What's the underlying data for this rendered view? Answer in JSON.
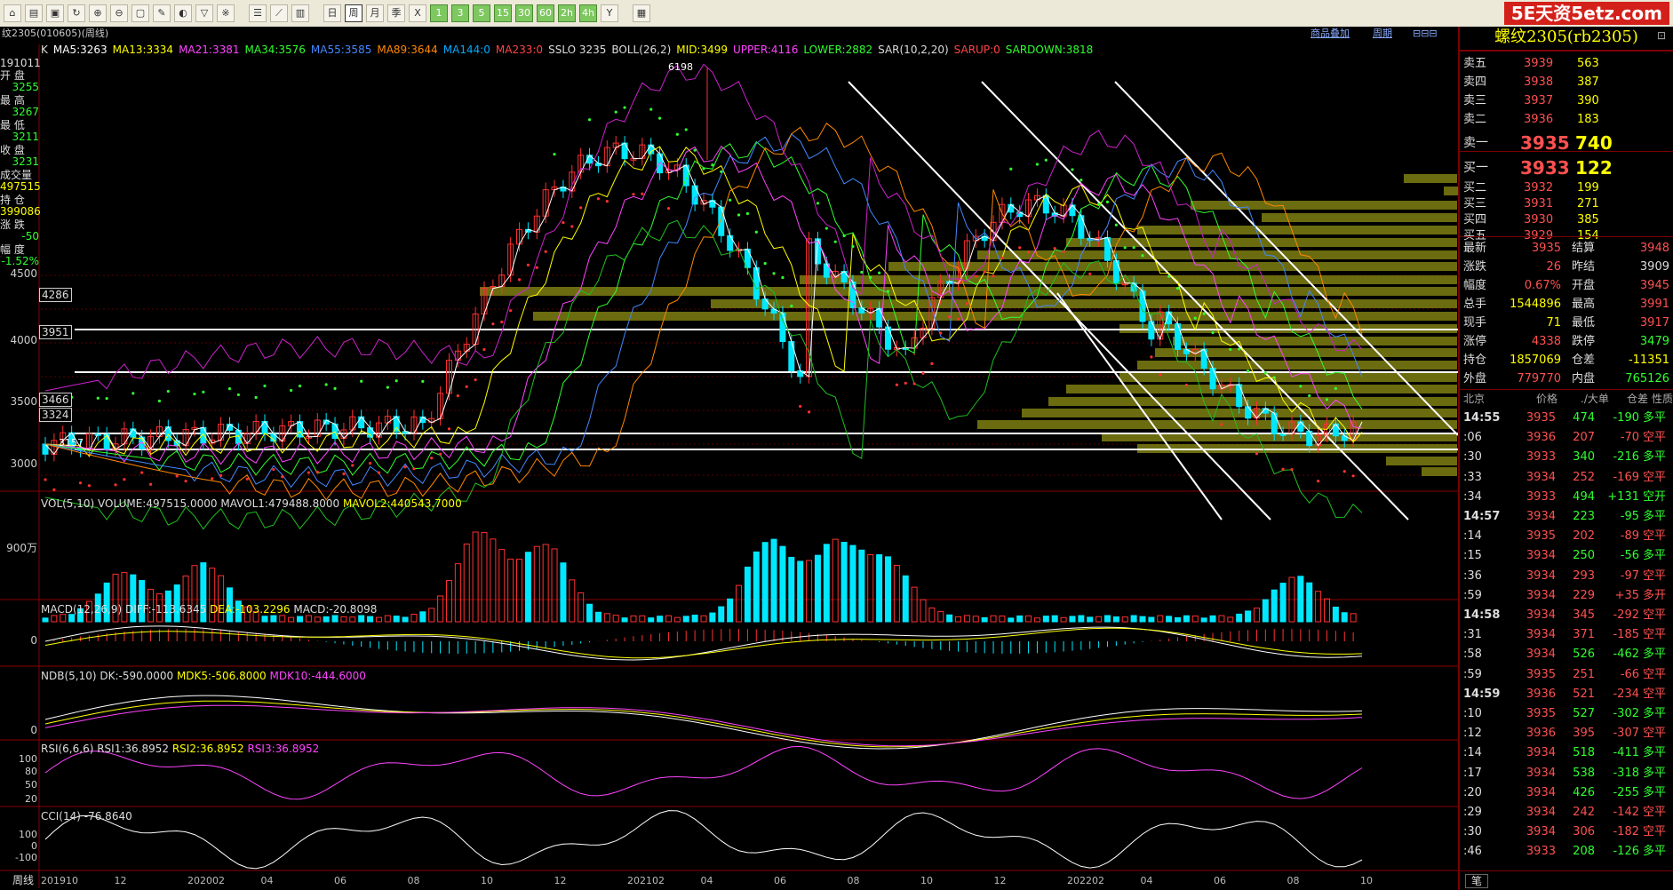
{
  "toolbar": {
    "icons": [
      "home-icon",
      "folder-icon",
      "open-icon",
      "refresh-icon",
      "zoom-in-icon",
      "zoom-out-icon",
      "window-icon",
      "pencil-icon",
      "color-icon",
      "filter-icon",
      "new-icon",
      "list-icon",
      "chart-icon",
      "tick-icon",
      "daily-icon",
      "weekly-icon",
      "monthly-icon",
      "quarter-icon",
      "x-icon",
      "1min-icon",
      "3min-icon",
      "5min-icon",
      "15min-icon",
      "30min-icon",
      "60min-icon",
      "2h-icon",
      "4h-icon",
      "year-icon",
      "calc-icon"
    ],
    "period_buttons": [
      "日",
      "周",
      "月",
      "季",
      "X",
      "1",
      "3",
      "5",
      "15",
      "30",
      "60",
      "2h",
      "4h",
      "Y"
    ],
    "brand": "5E天资5etz.com"
  },
  "chart_header": {
    "title": "纹2305(010605)(周线)",
    "links": [
      "商品叠加",
      "周期"
    ],
    "indicators": [
      {
        "text": "K",
        "color": "#dddddd"
      },
      {
        "text": "MA5:3263",
        "color": "#ffffff"
      },
      {
        "text": "MA13:3334",
        "color": "#ffff00"
      },
      {
        "text": "MA21:3381",
        "color": "#ff44ff"
      },
      {
        "text": "MA34:3576",
        "color": "#30ff30"
      },
      {
        "text": "MA55:3585",
        "color": "#4488ff"
      },
      {
        "text": "MA89:3644",
        "color": "#ff8800"
      },
      {
        "text": "MA144:0",
        "color": "#00aaff"
      },
      {
        "text": "MA233:0",
        "color": "#ff4444"
      },
      {
        "text": "SSLO 3235",
        "color": "#dddddd"
      },
      {
        "text": "BOLL(26,2)",
        "color": "#dddddd"
      },
      {
        "text": "MID:3499",
        "color": "#ffff00"
      },
      {
        "text": "UPPER:4116",
        "color": "#ff44ff"
      },
      {
        "text": "LOWER:2882",
        "color": "#30ff30"
      },
      {
        "text": "SAR(10,2,20)",
        "color": "#dddddd"
      },
      {
        "text": "SARUP:0",
        "color": "#ff4444"
      },
      {
        "text": "SARDOWN:3818",
        "color": "#30ff30"
      }
    ]
  },
  "left_panel": {
    "date": "191011",
    "rows": [
      {
        "label": "开 盘",
        "value": "3255",
        "color": "#30ff30"
      },
      {
        "label": "最 高",
        "value": "3267",
        "color": "#30ff30"
      },
      {
        "label": "最 低",
        "value": "3211",
        "color": "#30ff30"
      },
      {
        "label": "收 盘",
        "value": "3231",
        "color": "#30ff30"
      },
      {
        "label": "成交量",
        "value": "497515",
        "color": "#ffff00"
      },
      {
        "label": "持 仓",
        "value": "399086",
        "color": "#ffff00"
      },
      {
        "label": "涨 跌",
        "value": "-50",
        "color": "#30ff30"
      },
      {
        "label": "幅 度",
        "value": "-1.52%",
        "color": "#30ff30"
      }
    ]
  },
  "price_axis": {
    "ticks": [
      "4500",
      "4000",
      "3500",
      "3000"
    ],
    "boxes": [
      "4286",
      "3951",
      "3466",
      "3324"
    ],
    "annotations": [
      "6198",
      "3157"
    ]
  },
  "volume_panel": {
    "title": "VOL(5,10)",
    "text": "VOLUME:497515.0000",
    "mavol1": "MAVOL1:479488.8000",
    "mavol2": "MAVOL2:440543.7000",
    "tick": "900万"
  },
  "macd_panel": {
    "title": "MACD(12,26,9)",
    "diff": "DIFF:-113.6345",
    "dea": "DEA:-103.2296",
    "macd": "MACD:-20.8098",
    "tick": "0"
  },
  "ndb_panel": {
    "title": "NDB(5,10)",
    "dk": "DK:-590.0000",
    "mdk5": "MDK5:-506.8000",
    "mdk10": "MDK10:-444.6000",
    "tick": "0"
  },
  "rsi_panel": {
    "title": "RSI(6,6,6)",
    "rsi1": "RSI1:36.8952",
    "rsi2": "RSI2:36.8952",
    "rsi3": "RSI3:36.8952",
    "ticks": [
      "100",
      "80",
      "50",
      "20"
    ]
  },
  "cci_panel": {
    "title": "CCI(14)",
    "value": "-76.8640",
    "ticks": [
      "100",
      "0",
      "-100"
    ]
  },
  "x_axis": {
    "period_label": "周线",
    "labels": [
      "201910",
      "12",
      "202002",
      "04",
      "06",
      "08",
      "10",
      "12",
      "202102",
      "04",
      "06",
      "08",
      "10",
      "12",
      "202202",
      "04",
      "06",
      "08",
      "10"
    ]
  },
  "quote": {
    "title": "螺纹2305(rb2305)",
    "asks": [
      {
        "label": "卖五",
        "price": "3939",
        "vol": "563"
      },
      {
        "label": "卖四",
        "price": "3938",
        "vol": "387"
      },
      {
        "label": "卖三",
        "price": "3937",
        "vol": "390"
      },
      {
        "label": "卖二",
        "price": "3936",
        "vol": "183"
      },
      {
        "label": "卖一",
        "price": "3935",
        "vol": "740"
      }
    ],
    "bids": [
      {
        "label": "买一",
        "price": "3933",
        "vol": "122"
      },
      {
        "label": "买二",
        "price": "3932",
        "vol": "199"
      },
      {
        "label": "买三",
        "price": "3931",
        "vol": "271"
      },
      {
        "label": "买四",
        "price": "3930",
        "vol": "385"
      },
      {
        "label": "买五",
        "price": "3929",
        "vol": "154"
      }
    ],
    "stats": [
      {
        "l1": "最新",
        "v1": "3935",
        "c1": "#ff5050",
        "l2": "结算",
        "v2": "3948",
        "c2": "#ff5050"
      },
      {
        "l1": "涨跌",
        "v1": "26",
        "c1": "#ff5050",
        "l2": "昨结",
        "v2": "3909",
        "c2": "#dddddd"
      },
      {
        "l1": "幅度",
        "v1": "0.67%",
        "c1": "#ff5050",
        "l2": "开盘",
        "v2": "3945",
        "c2": "#ff5050"
      },
      {
        "l1": "总手",
        "v1": "1544896",
        "c1": "#ffff00",
        "l2": "最高",
        "v2": "3991",
        "c2": "#ff5050"
      },
      {
        "l1": "现手",
        "v1": "71",
        "c1": "#ffff00",
        "l2": "最低",
        "v2": "3917",
        "c2": "#ff5050"
      },
      {
        "l1": "涨停",
        "v1": "4338",
        "c1": "#ff5050",
        "l2": "跌停",
        "v2": "3479",
        "c2": "#30ff30"
      },
      {
        "l1": "持仓",
        "v1": "1857069",
        "c1": "#ffff00",
        "l2": "仓差",
        "v2": "-11351",
        "c2": "#ffff00"
      },
      {
        "l1": "外盘",
        "v1": "779770",
        "c1": "#ff5050",
        "l2": "内盘",
        "v2": "765126",
        "c2": "#30ff30"
      }
    ],
    "tick_header": [
      "北京",
      "价格",
      "./大单",
      "仓差",
      "性质"
    ],
    "ticks": [
      {
        "time": "14:55",
        "price": "3935",
        "vol": "474",
        "diff": "-190",
        "type": "多平",
        "vc": "#30ff30",
        "tc": "#30ff30",
        "bold": true
      },
      {
        "time": ":06",
        "price": "3936",
        "vol": "207",
        "diff": "-70",
        "type": "空平",
        "vc": "#ff5050",
        "tc": "#ff5050",
        "bold": false
      },
      {
        "time": ":30",
        "price": "3933",
        "vol": "340",
        "diff": "-216",
        "type": "多平",
        "vc": "#30ff30",
        "tc": "#30ff30",
        "bold": false
      },
      {
        "time": ":33",
        "price": "3934",
        "vol": "252",
        "diff": "-169",
        "type": "空平",
        "vc": "#ff5050",
        "tc": "#ff5050",
        "bold": false
      },
      {
        "time": ":34",
        "price": "3933",
        "vol": "494",
        "diff": "+131",
        "type": "空开",
        "vc": "#30ff30",
        "tc": "#30ff30",
        "bold": false
      },
      {
        "time": "14:57",
        "price": "3934",
        "vol": "223",
        "diff": "-95",
        "type": "多平",
        "vc": "#30ff30",
        "tc": "#30ff30",
        "bold": true
      },
      {
        "time": ":14",
        "price": "3935",
        "vol": "202",
        "diff": "-89",
        "type": "空平",
        "vc": "#ff5050",
        "tc": "#ff5050",
        "bold": false
      },
      {
        "time": ":15",
        "price": "3934",
        "vol": "250",
        "diff": "-56",
        "type": "多平",
        "vc": "#30ff30",
        "tc": "#30ff30",
        "bold": false
      },
      {
        "time": ":36",
        "price": "3934",
        "vol": "293",
        "diff": "-97",
        "type": "空平",
        "vc": "#ff5050",
        "tc": "#ff5050",
        "bold": false
      },
      {
        "time": ":59",
        "price": "3934",
        "vol": "229",
        "diff": "+35",
        "type": "多开",
        "vc": "#ff5050",
        "tc": "#ff5050",
        "bold": false
      },
      {
        "time": "14:58",
        "price": "3934",
        "vol": "345",
        "diff": "-292",
        "type": "空平",
        "vc": "#ff5050",
        "tc": "#ff5050",
        "bold": true
      },
      {
        "time": ":31",
        "price": "3934",
        "vol": "371",
        "diff": "-185",
        "type": "空平",
        "vc": "#ff5050",
        "tc": "#ff5050",
        "bold": false
      },
      {
        "time": ":58",
        "price": "3934",
        "vol": "526",
        "diff": "-462",
        "type": "多平",
        "vc": "#30ff30",
        "tc": "#30ff30",
        "bold": false
      },
      {
        "time": ":59",
        "price": "3935",
        "vol": "251",
        "diff": "-66",
        "type": "空平",
        "vc": "#ff5050",
        "tc": "#ff5050",
        "bold": false
      },
      {
        "time": "14:59",
        "price": "3936",
        "vol": "521",
        "diff": "-234",
        "type": "空平",
        "vc": "#ff5050",
        "tc": "#ff5050",
        "bold": true
      },
      {
        "time": ":10",
        "price": "3935",
        "vol": "527",
        "diff": "-302",
        "type": "多平",
        "vc": "#30ff30",
        "tc": "#30ff30",
        "bold": false
      },
      {
        "time": ":12",
        "price": "3936",
        "vol": "395",
        "diff": "-307",
        "type": "空平",
        "vc": "#ff5050",
        "tc": "#ff5050",
        "bold": false
      },
      {
        "time": ":14",
        "price": "3934",
        "vol": "518",
        "diff": "-411",
        "type": "多平",
        "vc": "#30ff30",
        "tc": "#30ff30",
        "bold": false
      },
      {
        "time": ":17",
        "price": "3934",
        "vol": "538",
        "diff": "-318",
        "type": "多平",
        "vc": "#30ff30",
        "tc": "#30ff30",
        "bold": false
      },
      {
        "time": ":20",
        "price": "3934",
        "vol": "426",
        "diff": "-255",
        "type": "多平",
        "vc": "#30ff30",
        "tc": "#30ff30",
        "bold": false
      },
      {
        "time": ":29",
        "price": "3934",
        "vol": "242",
        "diff": "-142",
        "type": "空平",
        "vc": "#ff5050",
        "tc": "#ff5050",
        "bold": false
      },
      {
        "time": ":30",
        "price": "3934",
        "vol": "306",
        "diff": "-182",
        "type": "空平",
        "vc": "#ff5050",
        "tc": "#ff5050",
        "bold": false
      },
      {
        "time": ":46",
        "price": "3933",
        "vol": "208",
        "diff": "-126",
        "type": "多平",
        "vc": "#30ff30",
        "tc": "#30ff30",
        "bold": false
      }
    ],
    "bottom_tab": "笔"
  }
}
